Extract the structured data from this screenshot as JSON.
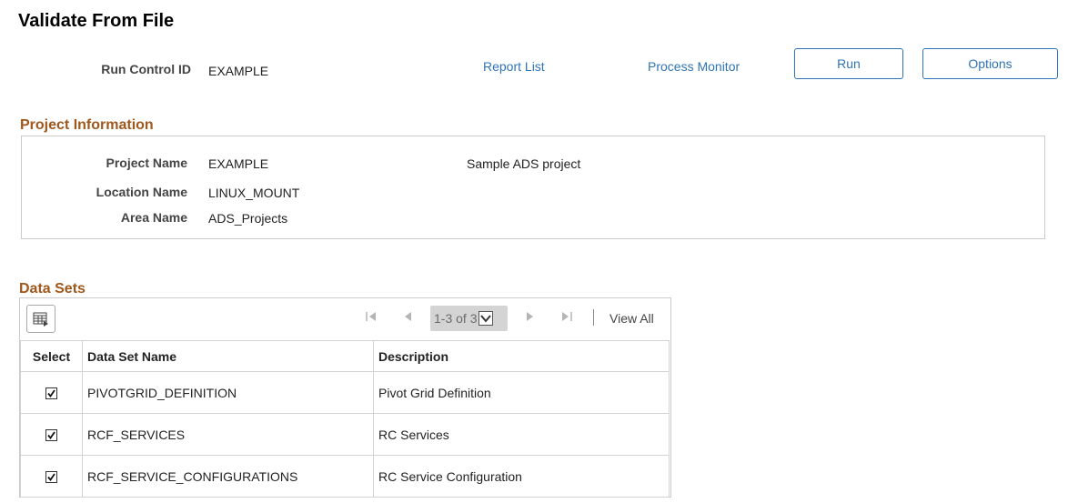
{
  "page": {
    "title": "Validate From File"
  },
  "header": {
    "run_control_label": "Run Control ID",
    "run_control_value": "EXAMPLE",
    "report_list": "Report List",
    "process_monitor": "Process Monitor",
    "run_button": "Run",
    "options_button": "Options"
  },
  "project": {
    "section_title": "Project Information",
    "name_label": "Project Name",
    "name_value": "EXAMPLE",
    "description": "Sample ADS project",
    "location_label": "Location Name",
    "location_value": "LINUX_MOUNT",
    "area_label": "Area Name",
    "area_value": "ADS_Projects"
  },
  "datasets": {
    "section_title": "Data Sets",
    "pager": "1-3 of 3",
    "view_all": "View All",
    "columns": {
      "select": "Select",
      "name": "Data Set Name",
      "description": "Description"
    },
    "rows": [
      {
        "name": "PIVOTGRID_DEFINITION",
        "description": "Pivot Grid Definition",
        "checked": true
      },
      {
        "name": "RCF_SERVICES",
        "description": "RC Services",
        "checked": true
      },
      {
        "name": "RCF_SERVICE_CONFIGURATIONS",
        "description": "RC Service Configuration",
        "checked": true
      }
    ]
  }
}
